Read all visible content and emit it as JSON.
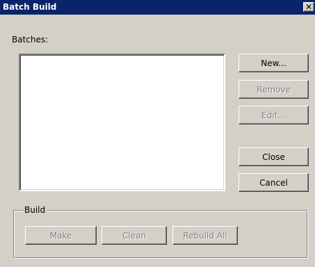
{
  "window": {
    "title": "Batch Build",
    "close_label": "✕"
  },
  "batches": {
    "label": "Batches:",
    "items": []
  },
  "side_buttons": {
    "new": "New...",
    "remove": "Remove",
    "edit": "Edit...",
    "close": "Close",
    "cancel": "Cancel"
  },
  "build": {
    "group_label": "Build",
    "make": "Make",
    "clean": "Clean",
    "rebuild_all": "Rebuild All"
  },
  "colors": {
    "titlebar": "#0a246a",
    "face": "#d4d0c8",
    "disabled_text": "#808080"
  }
}
